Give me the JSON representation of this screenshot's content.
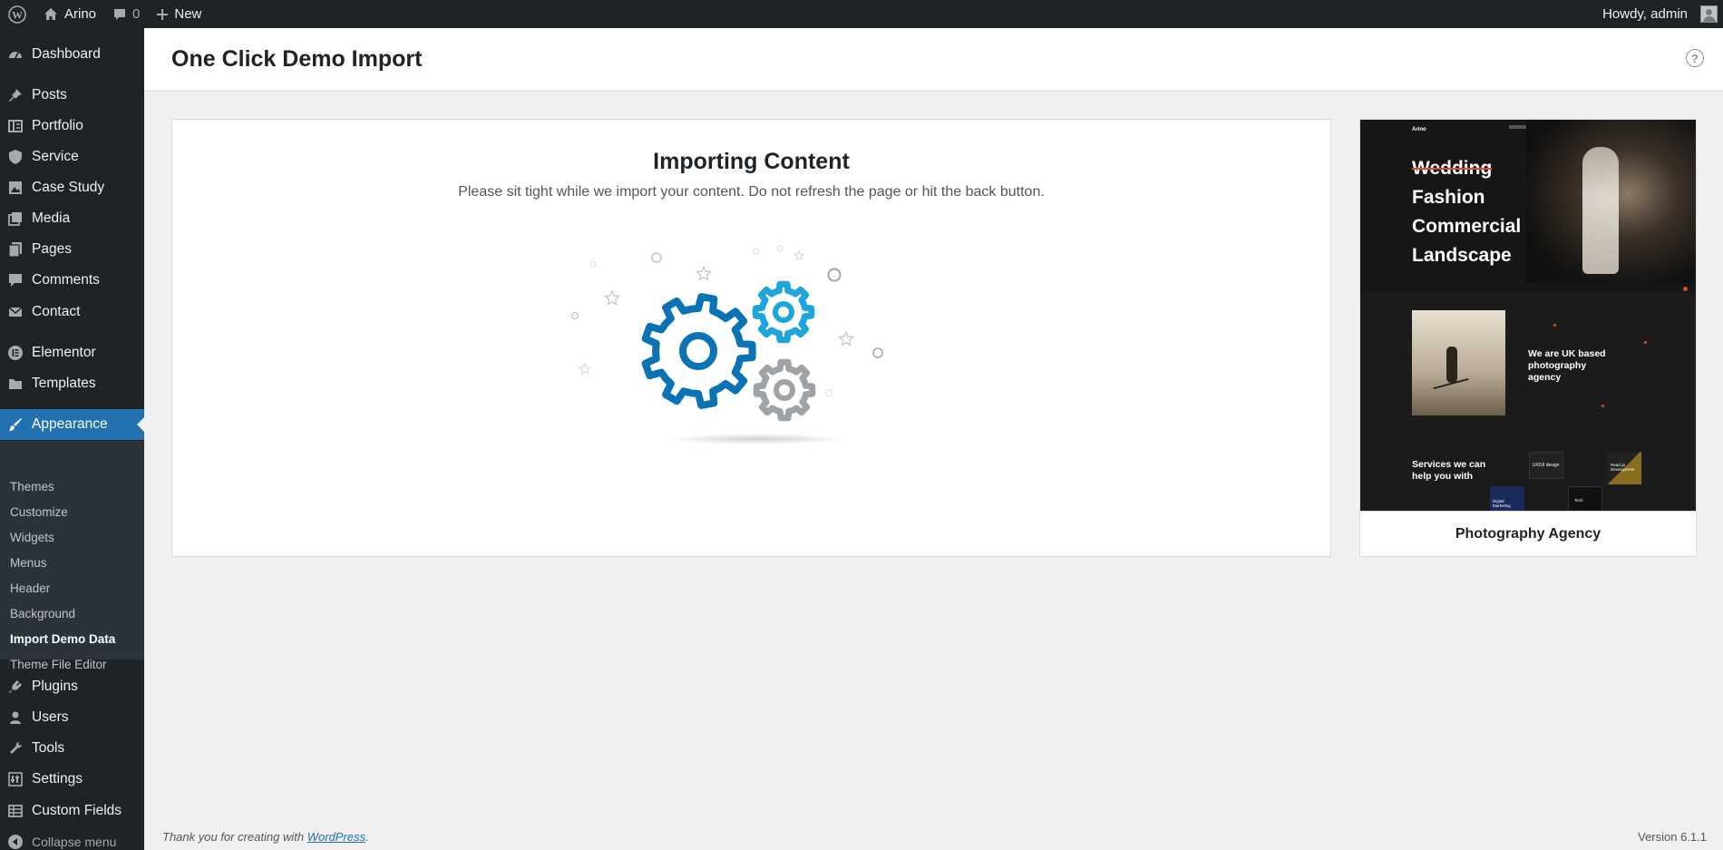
{
  "admin_bar": {
    "site_name": "Arino",
    "comments_count": "0",
    "new_label": "New",
    "howdy": "Howdy, admin"
  },
  "sidebar": {
    "items": [
      {
        "label": "Dashboard",
        "icon": "dashboard-icon"
      },
      {
        "label": "Posts",
        "icon": "pin-icon"
      },
      {
        "label": "Portfolio",
        "icon": "portfolio-icon"
      },
      {
        "label": "Service",
        "icon": "shield-icon"
      },
      {
        "label": "Case Study",
        "icon": "image-icon"
      },
      {
        "label": "Media",
        "icon": "media-icon"
      },
      {
        "label": "Pages",
        "icon": "pages-icon"
      },
      {
        "label": "Comments",
        "icon": "comment-icon"
      },
      {
        "label": "Contact",
        "icon": "email-icon"
      },
      {
        "label": "Elementor",
        "icon": "elementor-icon"
      },
      {
        "label": "Templates",
        "icon": "folder-icon"
      },
      {
        "label": "Appearance",
        "icon": "brush-icon"
      },
      {
        "label": "Plugins",
        "icon": "plugin-icon"
      },
      {
        "label": "Users",
        "icon": "users-icon"
      },
      {
        "label": "Tools",
        "icon": "wrench-icon"
      },
      {
        "label": "Settings",
        "icon": "settings-icon"
      },
      {
        "label": "Custom Fields",
        "icon": "table-icon"
      },
      {
        "label": "Collapse menu",
        "icon": "collapse-icon"
      }
    ],
    "submenu": [
      "Themes",
      "Customize",
      "Widgets",
      "Menus",
      "Header",
      "Background",
      "Import Demo Data",
      "Theme File Editor"
    ]
  },
  "page": {
    "title": "One Click Demo Import",
    "import_title": "Importing Content",
    "import_desc": "Please sit tight while we import your content. Do not refresh the page or hit the back button."
  },
  "demo": {
    "name": "Photography Agency",
    "preview": {
      "logo": "Arino",
      "headline": [
        "Wedding",
        "Fashion",
        "Commercial",
        "Landscape"
      ],
      "about": "We are UK based photography agency",
      "services": "Services we can help you with",
      "tiles": [
        "UX/UI design",
        "React.js Development",
        "Digital Marketing",
        "Tech"
      ]
    }
  },
  "footer": {
    "thanks_prefix": "Thank you for creating with ",
    "wordpress_link": "WordPress",
    "thanks_suffix": ".",
    "version": "Version 6.1.1"
  },
  "colors": {
    "admin_bg": "#1d2327",
    "accent": "#2271b1",
    "gear_dark": "#0a73b5",
    "gear_light": "#1ea5dc",
    "gear_gray": "#a0a3a6"
  }
}
